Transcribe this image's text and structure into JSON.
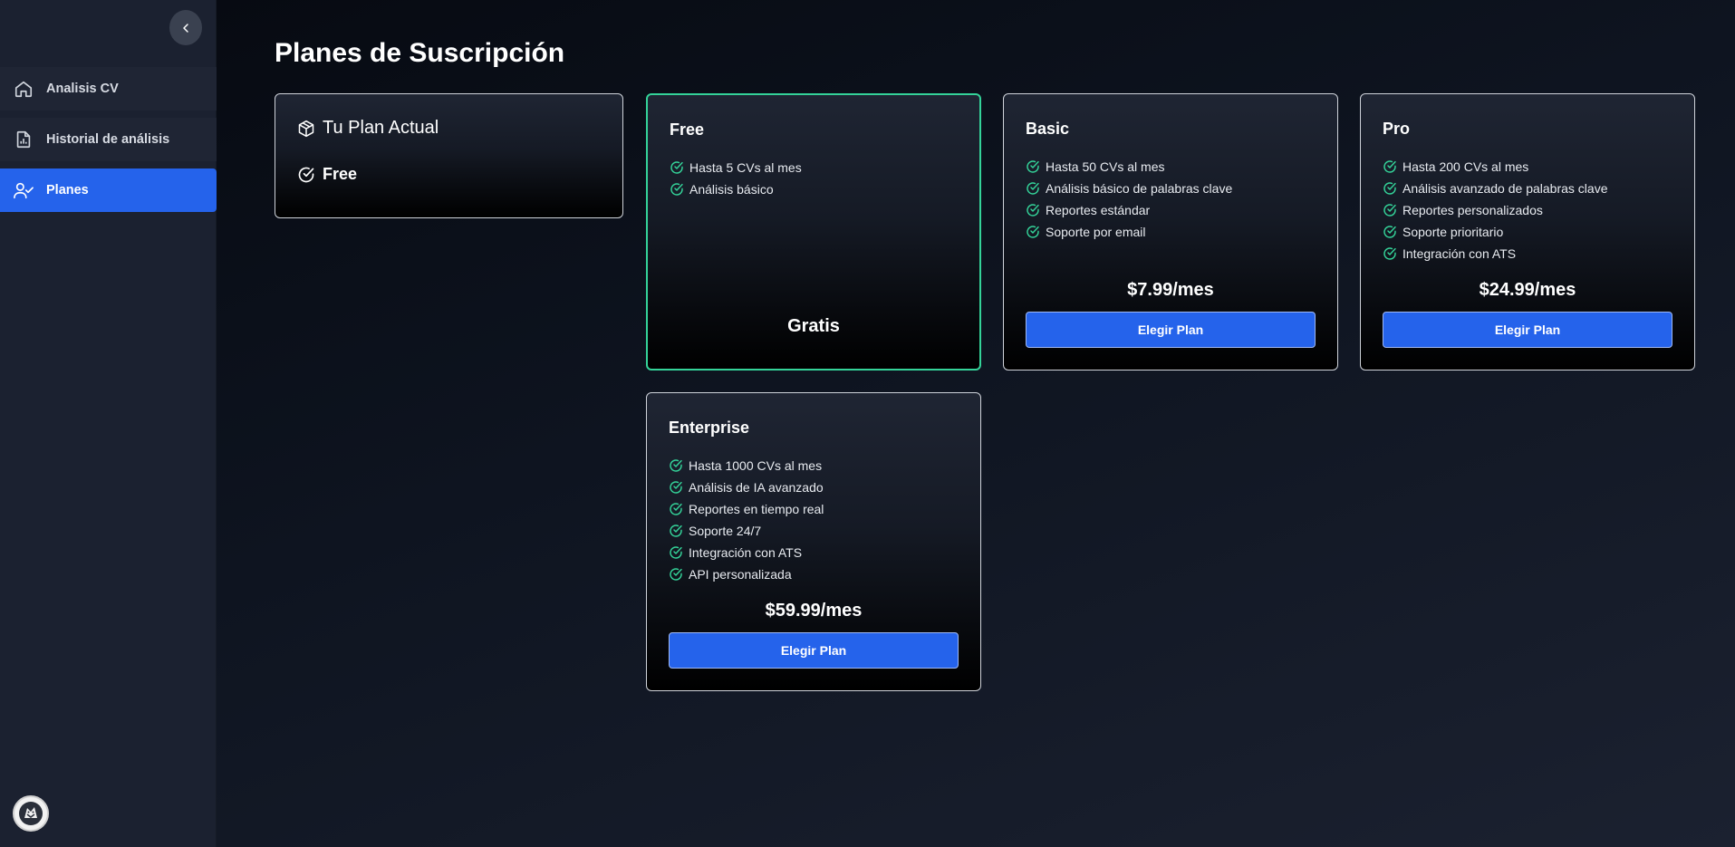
{
  "sidebar": {
    "items": [
      {
        "label": "Analisis CV",
        "icon": "home-icon"
      },
      {
        "label": "Historial de análisis",
        "icon": "file-chart-icon"
      },
      {
        "label": "Planes",
        "icon": "user-check-icon",
        "active": true
      }
    ]
  },
  "page": {
    "title": "Planes de Suscripción"
  },
  "current_plan": {
    "heading": "Tu Plan Actual",
    "value": "Free"
  },
  "plans": [
    {
      "name": "Free",
      "features": [
        "Hasta 5 CVs al mes",
        "Análisis básico"
      ],
      "price": "Gratis",
      "selected": true
    },
    {
      "name": "Basic",
      "features": [
        "Hasta 50 CVs al mes",
        "Análisis básico de palabras clave",
        "Reportes estándar",
        "Soporte por email"
      ],
      "price": "$7.99/mes",
      "button": "Elegir Plan"
    },
    {
      "name": "Pro",
      "features": [
        "Hasta 200 CVs al mes",
        "Análisis avanzado de palabras clave",
        "Reportes personalizados",
        "Soporte prioritario",
        "Integración con ATS"
      ],
      "price": "$24.99/mes",
      "button": "Elegir Plan"
    },
    {
      "name": "Enterprise",
      "features": [
        "Hasta 1000 CVs al mes",
        "Análisis de IA avanzado",
        "Reportes en tiempo real",
        "Soporte 24/7",
        "Integración con ATS",
        "API personalizada"
      ],
      "price": "$59.99/mes",
      "button": "Elegir Plan"
    }
  ],
  "colors": {
    "accent": "#2563eb",
    "check": "#34d399",
    "sidebar_bg": "#1b2130"
  }
}
